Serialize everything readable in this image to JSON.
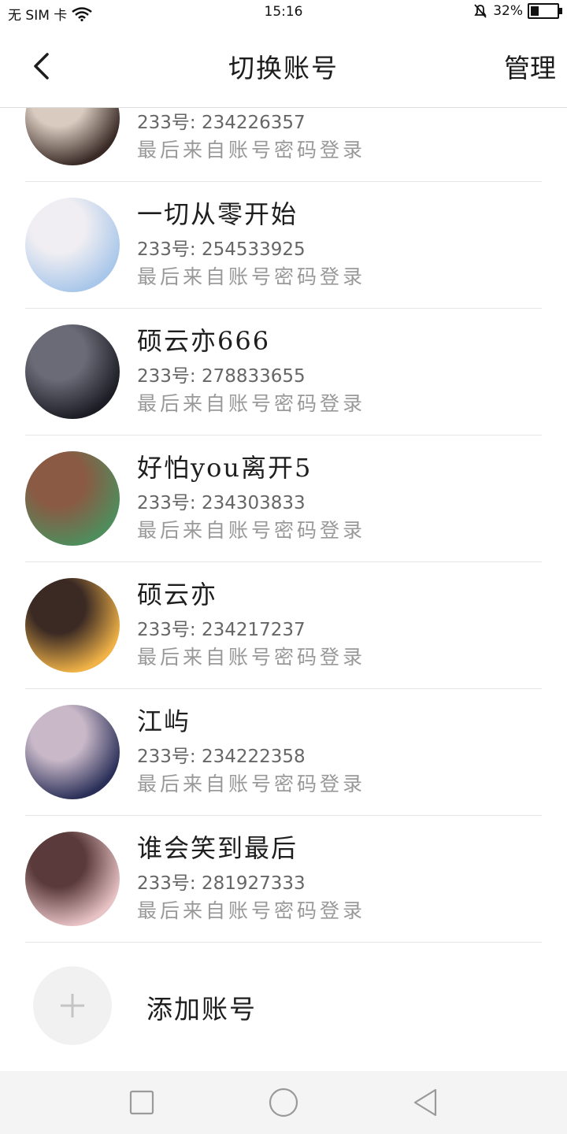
{
  "status_bar": {
    "carrier": "无 SIM 卡",
    "time": "15:16",
    "battery": "32%",
    "battery_level": 0.32
  },
  "header": {
    "title": "切换账号",
    "manage_label": "管理"
  },
  "accounts": [
    {
      "name": "",
      "id": "233号: 234226357",
      "source": "最后来自账号密码登录",
      "avatar_colors": [
        "#3a2a26",
        "#d9cbbf"
      ]
    },
    {
      "name": "一切从零开始",
      "id": "233号: 254533925",
      "source": "最后来自账号密码登录",
      "avatar_colors": [
        "#a9c7ea",
        "#f0eef2"
      ]
    },
    {
      "name": "硕云亦666",
      "id": "233号: 278833655",
      "source": "最后来自账号密码登录",
      "avatar_colors": [
        "#1c1c24",
        "#6b6b78"
      ]
    },
    {
      "name": "好怕you离开5",
      "id": "233号: 234303833",
      "source": "最后来自账号密码登录",
      "avatar_colors": [
        "#4f8d5c",
        "#8a5a44"
      ]
    },
    {
      "name": "硕云亦",
      "id": "233号: 234217237",
      "source": "最后来自账号密码登录",
      "avatar_colors": [
        "#f1b347",
        "#3b2a24"
      ]
    },
    {
      "name": "江屿",
      "id": "233号: 234222358",
      "source": "最后来自账号密码登录",
      "avatar_colors": [
        "#2a2f58",
        "#c8b8c8"
      ]
    },
    {
      "name": "谁会笑到最后",
      "id": "233号: 281927333",
      "source": "最后来自账号密码登录",
      "avatar_colors": [
        "#e8c3c6",
        "#5a3a3a"
      ]
    }
  ],
  "add_account_label": "添加账号",
  "nav": {
    "icons": [
      "recent-apps-icon",
      "home-icon",
      "back-triangle-icon"
    ]
  }
}
